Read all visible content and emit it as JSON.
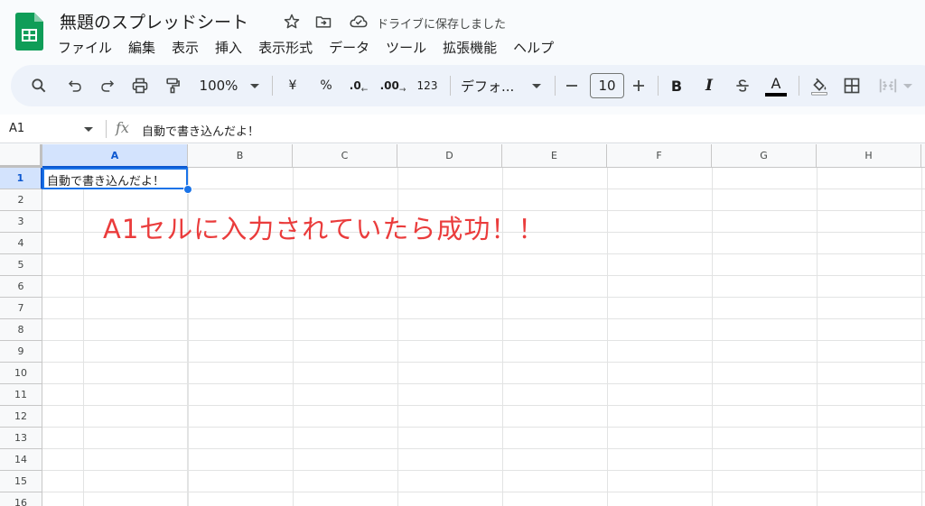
{
  "header": {
    "doc_title": "無題のスプレッドシート",
    "save_status": "ドライブに保存しました",
    "icons": [
      "star-icon",
      "move-to-folder-icon",
      "cloud-saved-icon"
    ]
  },
  "menu": [
    "ファイル",
    "編集",
    "表示",
    "挿入",
    "表示形式",
    "データ",
    "ツール",
    "拡張機能",
    "ヘルプ"
  ],
  "toolbar": {
    "zoom": "100%",
    "currency": "¥",
    "percent": "%",
    "decrease_decimal": ".0",
    "increase_decimal": ".00",
    "more_formats": "123",
    "font": "デフォ...",
    "font_size": "10",
    "bold": "B",
    "italic": "I",
    "text_color": "A"
  },
  "formula_bar": {
    "name_box": "A1",
    "fx": "fx",
    "content": "自動で書き込んだよ！"
  },
  "sheet": {
    "columns": [
      "A",
      "B",
      "C",
      "D",
      "E",
      "F",
      "G",
      "H"
    ],
    "rows": [
      "1",
      "2",
      "3",
      "4",
      "5",
      "6",
      "7",
      "8",
      "9",
      "10",
      "11",
      "12",
      "13",
      "14",
      "15",
      "16"
    ],
    "selected_cell": "A1",
    "a1_value": "自動で書き込んだよ！"
  },
  "annotation": "A1セルに入力されていたら成功！！",
  "colors": {
    "accent": "#1a73e8",
    "annotation": "#ea3c3c",
    "logo": "#0f9d58"
  }
}
